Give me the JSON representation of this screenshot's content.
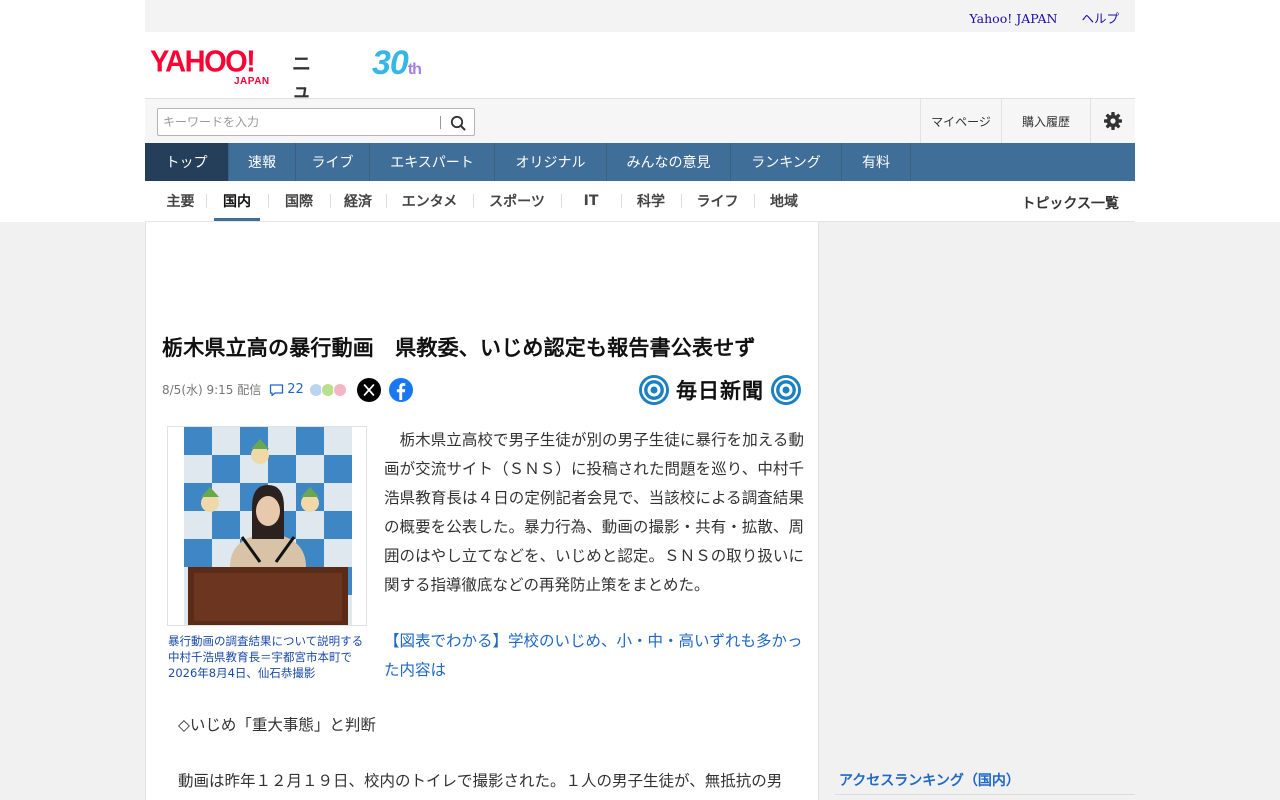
{
  "topbar": {
    "links": [
      "Yahoo! JAPAN",
      "ヘルプ"
    ]
  },
  "logo": {
    "brand": "YAHOO!",
    "sub": "JAPAN",
    "service": "ニュース",
    "anniversary": "30",
    "anniversary_suffix": "th"
  },
  "search": {
    "placeholder": "キーワードを入力"
  },
  "tools": {
    "mypage": "マイページ",
    "history": "購入履歴"
  },
  "nav": [
    "トップ",
    "速報",
    "ライブ",
    "エキスパート",
    "オリジナル",
    "みんなの意見",
    "ランキング",
    "有料"
  ],
  "categories": [
    "主要",
    "国内",
    "国際",
    "経済",
    "エンタメ",
    "スポーツ",
    "IT",
    "科学",
    "ライフ",
    "地域"
  ],
  "topics_link": "トピックス一覧",
  "article": {
    "title": "栃木県立高の暴行動画　県教委、いじめ認定も報告書公表せず",
    "date": "8/5(水) 9:15 配信",
    "comment_count": "22",
    "publisher": "毎日新聞",
    "photo_caption": "暴行動画の調査結果について説明する中村千浩県教育長＝宇都宮市本町で2026年8月4日、仙石恭撮影",
    "body": "　栃木県立高校で男子生徒が別の男子生徒に暴行を加える動画が交流サイト（ＳＮＳ）に投稿された問題を巡り、中村千浩県教育長は４日の定例記者会見で、当該校による調査結果の概要を公表した。暴力行為、動画の撮影・共有・拡散、周囲のはやし立てなどを、いじめと認定。ＳＮＳの取り扱いに関する指導徹底などの再発防止策をまとめた。",
    "link": "【図表でわかる】学校のいじめ、小・中・高いずれも多かった内容は",
    "subhead": "◇いじめ「重大事態」と判断",
    "paragraph2": "動画は昨年１２月１９日、校内のトイレで撮影された。１人の男子生徒が、無抵抗の男"
  },
  "sidebar": {
    "ranking_title": "アクセスランキング（国内）"
  },
  "colors": {
    "nav": "#3f6e99",
    "nav_active": "#253f5b",
    "link": "#1f68c8",
    "brand": "#ff0033"
  }
}
